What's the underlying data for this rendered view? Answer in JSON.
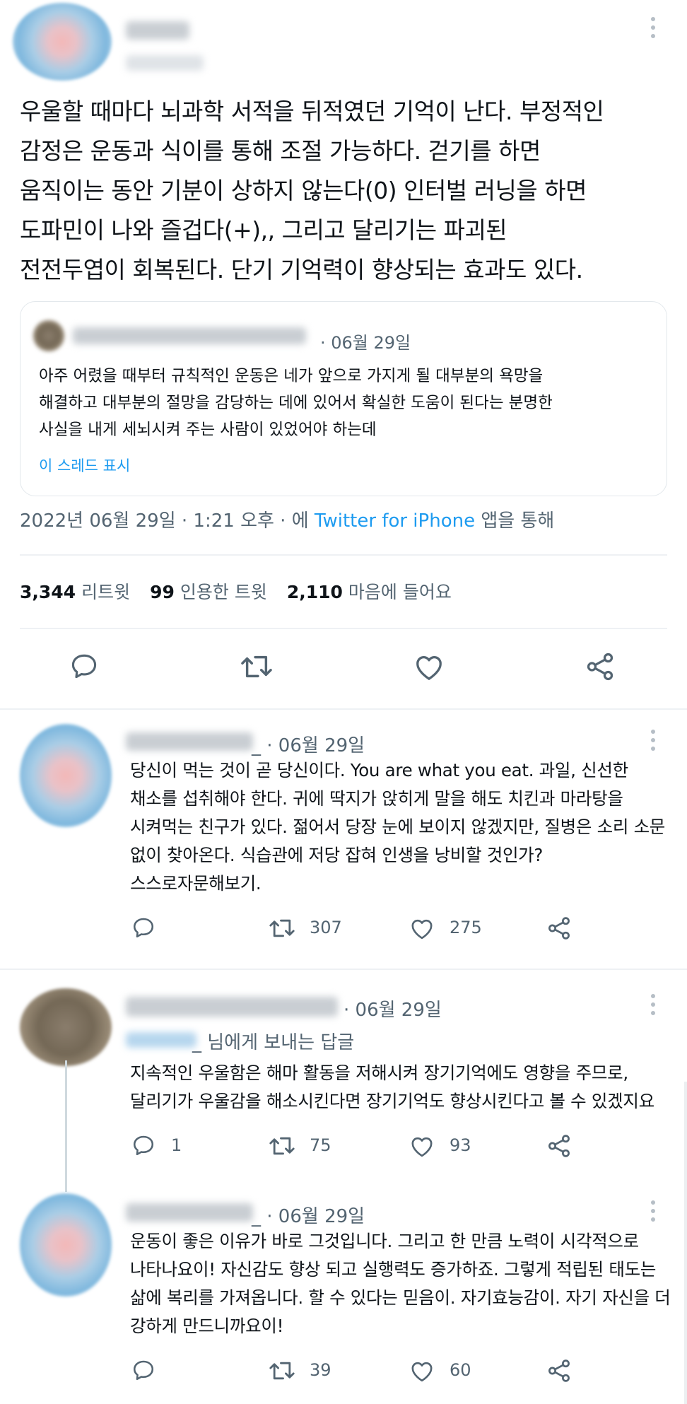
{
  "main_tweet": {
    "handle_suffix": "...",
    "text": "우울할 때마다 뇌과학 서적을 뒤적였던 기억이 난다. 부정적인\n감정은 운동과 식이를 통해 조절 가능하다. 걷기를 하면\n움직이는 동안 기분이 상하지 않는다(0) 인터벌 러닝을 하면\n도파민이 나와 즐겁다(+),, 그리고 달리기는 파괴된\n전전두엽이 회복된다. 단기 기억력이 향상되는 효과도 있다.",
    "quote": {
      "date": "· 06월 29일",
      "text": "아주 어렸을 때부터 규칙적인 운동은 네가 앞으로 가지게 될 대부분의 욕망을\n해결하고 대부분의 절망을 감당하는 데에 있어서 확실한 도움이 된다는 분명한\n사실을 내게 세뇌시켜 주는 사람이 있었어야 하는데",
      "show_thread": "이 스레드 표시"
    },
    "meta": {
      "datetime": "2022년 06월 29일 · 1:21 오후 · 에 ",
      "source": "Twitter for iPhone",
      "suffix": " 앱을 통해"
    },
    "stats": {
      "retweets": "3,344",
      "retweets_label": "리트윗",
      "quotes": "99",
      "quotes_label": "인용한 트윗",
      "likes": "2,110",
      "likes_label": "마음에 들어요"
    }
  },
  "replies": [
    {
      "date": "_ · 06월 29일",
      "text": "당신이 먹는 것이 곧 당신이다. You are what you eat. 과일, 신선한\n채소를 섭취해야 한다. 귀에 딱지가 앉히게 말을 해도 치킨과 마라탕을\n시켜먹는 친구가 있다. 젊어서 당장 눈에 보이지 않겠지만, 질병은 소리 소문\n없이 찾아온다. 식습관에 저당 잡혀 인생을 낭비할 것인가?\n스스로자문해보기.",
      "reply_count": "",
      "retweet_count": "307",
      "like_count": "275"
    },
    {
      "date": "· 06월 29일",
      "reply_to": "_ 님에게 보내는 답글",
      "text": "지속적인 우울함은 해마 활동을 저해시켜 장기기억에도 영향을 주므로,\n달리기가 우울감을 해소시킨다면 장기기억도 향상시킨다고 볼 수 있겠지요",
      "reply_count": "1",
      "retweet_count": "75",
      "like_count": "93"
    },
    {
      "date": "_ · 06월 29일",
      "text": "운동이 좋은 이유가 바로 그것입니다. 그리고 한 만큼 노력이 시각적으로\n나타나요이! 자신감도 향상 되고 실행력도 증가하죠. 그렇게 적립된 태도는\n삶에 복리를 가져옵니다. 할 수 있다는 믿음이. 자기효능감이. 자기 자신을 더\n강하게 만드니까요이!",
      "reply_count": "",
      "retweet_count": "39",
      "like_count": "60"
    }
  ],
  "colors": {
    "accent": "#1d9bf0",
    "muted": "#536471",
    "text": "#0f1419",
    "border": "#e3e8ec"
  }
}
